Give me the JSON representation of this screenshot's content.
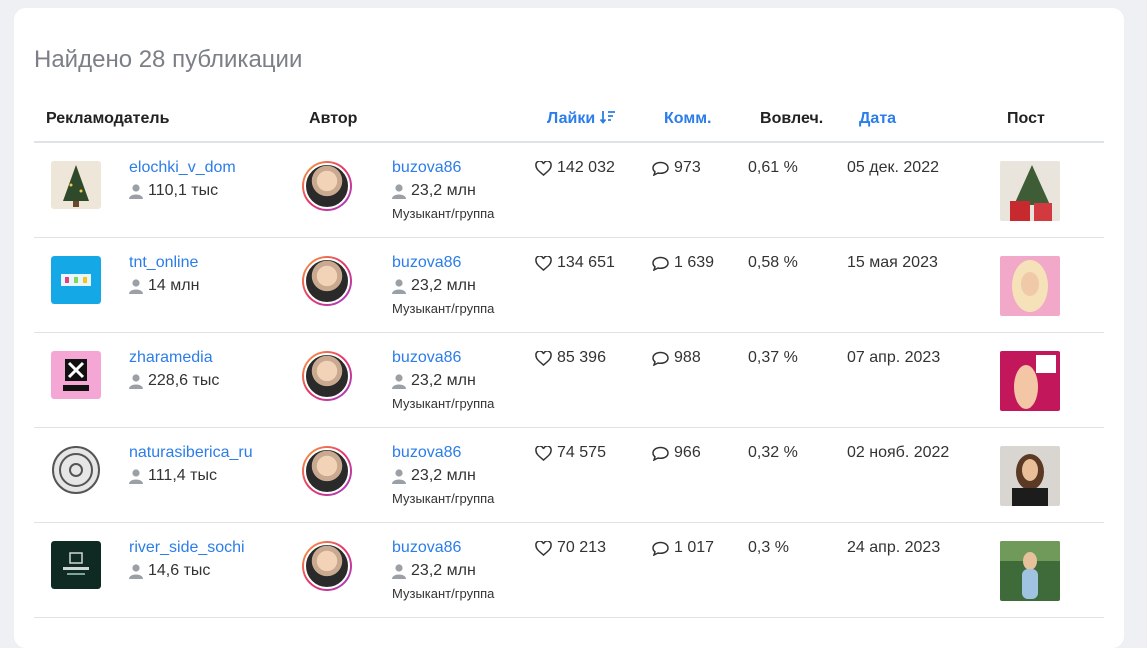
{
  "heading": "Найдено 28 публикации",
  "columns": {
    "advertiser": "Рекламодатель",
    "author": "Автор",
    "likes": "Лайки",
    "comments": "Комм.",
    "engagement": "Вовлеч.",
    "date": "Дата",
    "post": "Пост"
  },
  "colors": {
    "link": "#2b7de9",
    "border": "#dfe2e6",
    "heading": "#7b7f86"
  },
  "rows": [
    {
      "advertiser": "elochki_v_dom",
      "advertiser_followers": "110,1 тыс",
      "author": "buzova86",
      "author_followers": "23,2 млн",
      "author_category": "Музыкант/группа",
      "likes": "142 032",
      "comments": "973",
      "engagement": "0,61 %",
      "date": "05 дек. 2022"
    },
    {
      "advertiser": "tnt_online",
      "advertiser_followers": "14 млн",
      "author": "buzova86",
      "author_followers": "23,2 млн",
      "author_category": "Музыкант/группа",
      "likes": "134 651",
      "comments": "1 639",
      "engagement": "0,58 %",
      "date": "15 мая 2023"
    },
    {
      "advertiser": "zharamedia",
      "advertiser_followers": "228,6 тыс",
      "author": "buzova86",
      "author_followers": "23,2 млн",
      "author_category": "Музыкант/группа",
      "likes": "85 396",
      "comments": "988",
      "engagement": "0,37 %",
      "date": "07 апр. 2023"
    },
    {
      "advertiser": "naturasiberica_ru",
      "advertiser_followers": "111,4 тыс",
      "author": "buzova86",
      "author_followers": "23,2 млн",
      "author_category": "Музыкант/группа",
      "likes": "74 575",
      "comments": "966",
      "engagement": "0,32 %",
      "date": "02 нояб. 2022"
    },
    {
      "advertiser": "river_side_sochi",
      "advertiser_followers": "14,6 тыс",
      "author": "buzova86",
      "author_followers": "23,2 млн",
      "author_category": "Музыкант/группа",
      "likes": "70 213",
      "comments": "1 017",
      "engagement": "0,3 %",
      "date": "24 апр. 2023"
    }
  ]
}
